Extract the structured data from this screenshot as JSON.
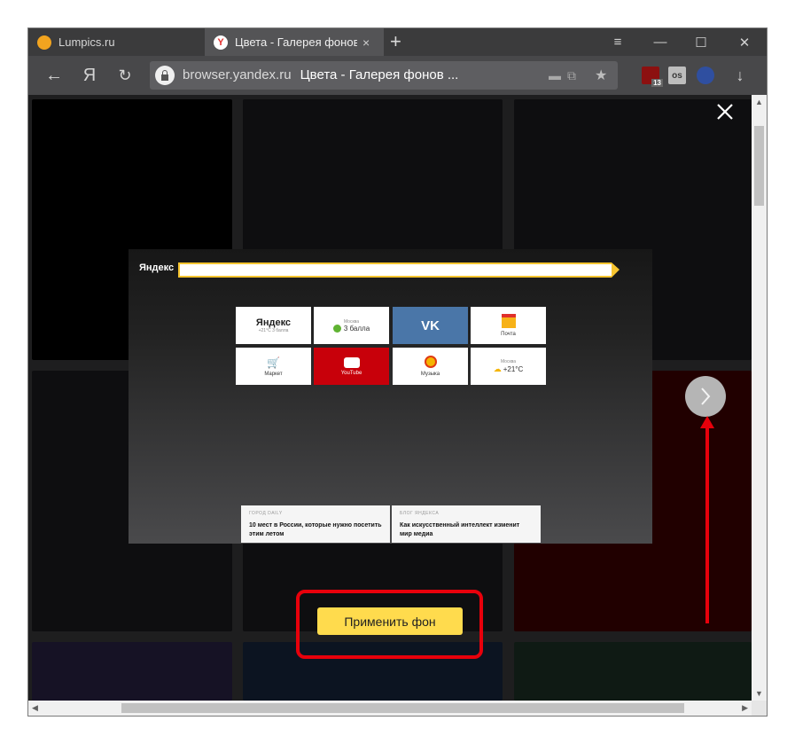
{
  "tabs": [
    {
      "title": "Lumpics.ru"
    },
    {
      "title": "Цвета - Галерея фонов",
      "close": "×"
    }
  ],
  "window_controls": {
    "menu": "≡",
    "minimize": "—",
    "maximize": "☐",
    "close": "✕"
  },
  "toolbar": {
    "back": "←",
    "yandex": "Я",
    "reload": "↻",
    "download": "↓"
  },
  "address": {
    "host": "browser.yandex.ru",
    "title": "Цвета - Галерея фонов ..."
  },
  "extensions": {
    "ublock_count": "13",
    "lastpass": "os"
  },
  "preview": {
    "logo": "Яндекс",
    "tiles": [
      {
        "title": "Яндекс",
        "sub1": "+21°C",
        "sub2": "3 балла"
      },
      {
        "title": "Москва",
        "value": "3 балла"
      },
      {
        "title": "VK"
      },
      {
        "title": "Почта"
      },
      {
        "title": "Маркет"
      },
      {
        "title": "YouTube"
      },
      {
        "title": "Музыка"
      },
      {
        "title": "Москва",
        "value": "+21°C"
      }
    ],
    "news": [
      {
        "source": "ГОРОД DAILY",
        "text": "10 мест в России, которые нужно посетить этим летом"
      },
      {
        "source": "БЛОГ ЯНДЕКСА",
        "text": "Как искусственный интеллект изменит мир медиа"
      }
    ]
  },
  "apply_button": "Применить фон",
  "colors": {
    "highlight": "#e8000b",
    "apply": "#ffdb4d"
  }
}
